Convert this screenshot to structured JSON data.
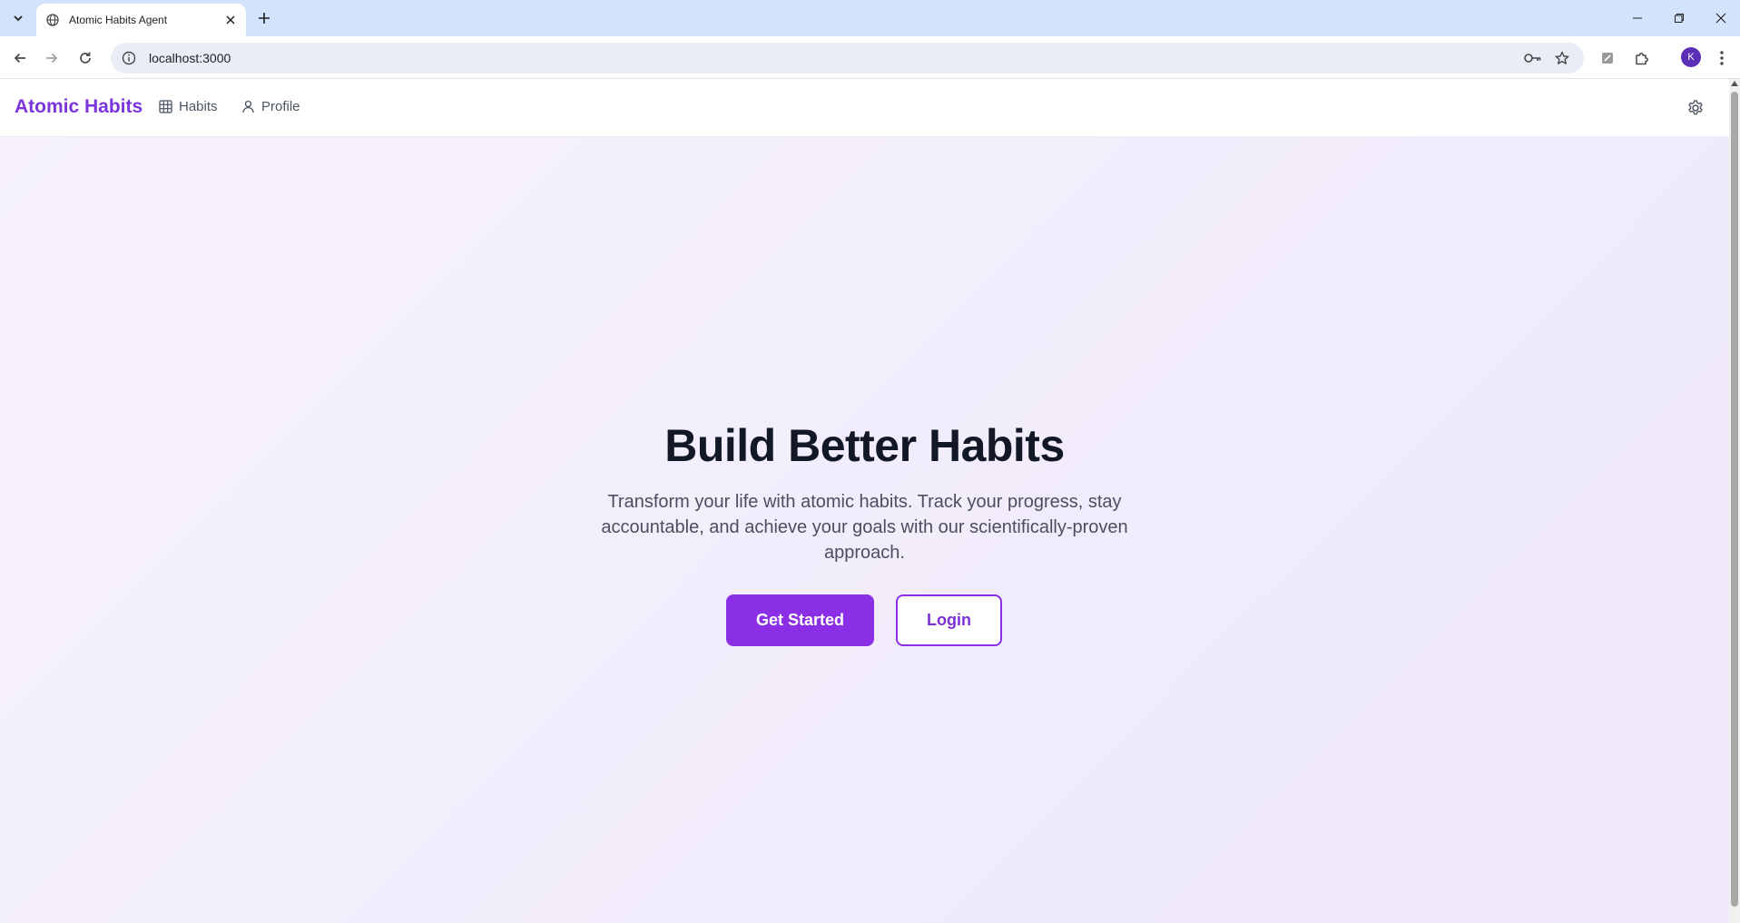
{
  "browser": {
    "tab_title": "Atomic Habits Agent",
    "url": "localhost:3000",
    "avatar_letter": "K"
  },
  "header": {
    "brand": "Atomic Habits",
    "nav": [
      {
        "label": "Habits",
        "icon": "grid-icon"
      },
      {
        "label": "Profile",
        "icon": "user-icon"
      }
    ],
    "settings_icon": "gear-icon"
  },
  "hero": {
    "title": "Build Better Habits",
    "description": "Transform your life with atomic habits. Track your progress, stay accountable, and achieve your goals with our scientifically-proven approach.",
    "primary_button": "Get Started",
    "secondary_button": "Login"
  },
  "colors": {
    "brand": "#7c35dd",
    "primary_button": "#8a2fe6",
    "background": "#f3eefc",
    "title": "#121826"
  }
}
